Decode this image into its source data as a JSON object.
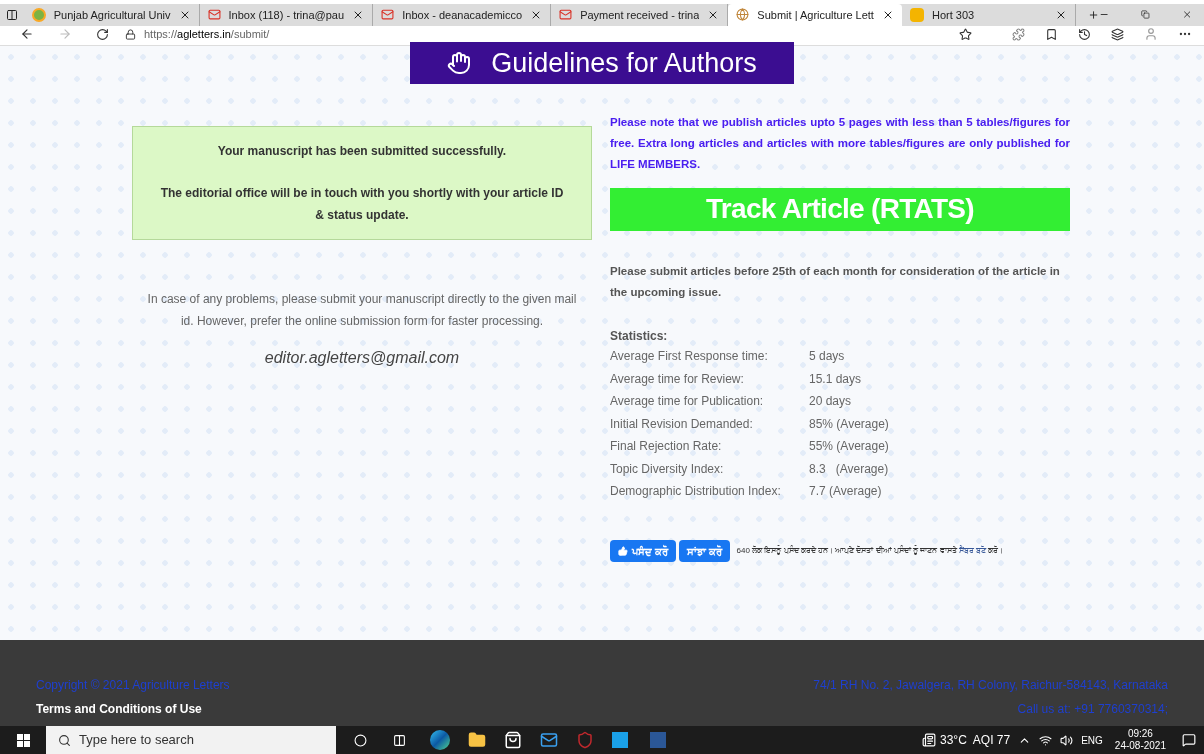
{
  "browser": {
    "tabs": [
      {
        "label": "Punjab Agricultural Univ",
        "selected": false,
        "kind": "pau"
      },
      {
        "label": "Inbox (118) - trina@pau",
        "selected": false,
        "kind": "gmail"
      },
      {
        "label": "Inbox - deanacademicco",
        "selected": false,
        "kind": "gmail"
      },
      {
        "label": "Payment received - trina",
        "selected": false,
        "kind": "gmail"
      },
      {
        "label": "Submit | Agriculture Lett",
        "selected": true,
        "kind": "site"
      },
      {
        "label": "Hort 303",
        "selected": false,
        "kind": "slides"
      }
    ],
    "address": {
      "protocol": "https://",
      "domain": "agletters.in",
      "path": "/submit/"
    }
  },
  "page": {
    "guidelines_button": "Guidelines for Authors",
    "success_box": {
      "line_1": "Your manuscript has been submitted successfully.",
      "line_2": "The editorial office will be in touch with you shortly with your article ID & status update."
    },
    "problems_note": "In case of any problems, please submit your manuscript directly to the given mail id. However, prefer the online submission form for faster processing.",
    "email": "editor.agletters@gmail.com",
    "pages_note": "Please note that we publish articles upto 5 pages with less than 5 tables/figures for free. Extra long articles and articles with more tables/figures are only published for LIFE MEMBERS.",
    "track_button": "Track Article (RTATS)",
    "deadline_note": "Please submit articles before 25th of each month for consideration of the article in the upcoming issue.",
    "statistics": {
      "title": "Statistics:",
      "rows": [
        {
          "label": "Average First Response time:",
          "value": "5 days"
        },
        {
          "label": "Average time for Review:",
          "value": "15.1 days"
        },
        {
          "label": "Average time for Publication:",
          "value": "20 days"
        },
        {
          "label": "Initial Revision Demanded:",
          "value": "85% (Average)"
        },
        {
          "label": "Final Rejection Rate:",
          "value": "55% (Average)"
        },
        {
          "label": "Topic Diversity Index:",
          "value": "8.3   (Average)"
        },
        {
          "label": "Demographic Distribution Index:",
          "value": "7.7 (Average)"
        }
      ]
    },
    "facebook": {
      "like_button": "ਪਸੰਦ ਕਰੋ",
      "share_button": "ਸਾਂਝਾ ਕਰੋ",
      "text": "640 ਲੋਕ ਇਸਨੂੰ ਪਸੰਦ ਕਰਦੇ ਹਨ। ਆਪਣੇ ਦੋਸਤਾਂ ਦੀਆਂ ਪਸੰਦਾਂ ਨੂੰ ਜਾਣਨ ਵਾਸਤੇ",
      "link": "ਸੈਂਬਰ ਬਣੋ",
      "text_end": "ਕਰੋ।"
    }
  },
  "footer": {
    "copyright": "Copyright © 2021 Agriculture Letters",
    "terms": "Terms and Conditions of Use",
    "address": "74/1 RH No. 2, Jawalgera, RH Colony, Raichur-584143, Karnataka",
    "phone": "Call us at: +91 7760370314;"
  },
  "taskbar": {
    "search_placeholder": "Type here to search",
    "weather": "33°C  AQI 77",
    "language": "ENG",
    "time": "09:26",
    "date": "24-08-2021"
  }
}
